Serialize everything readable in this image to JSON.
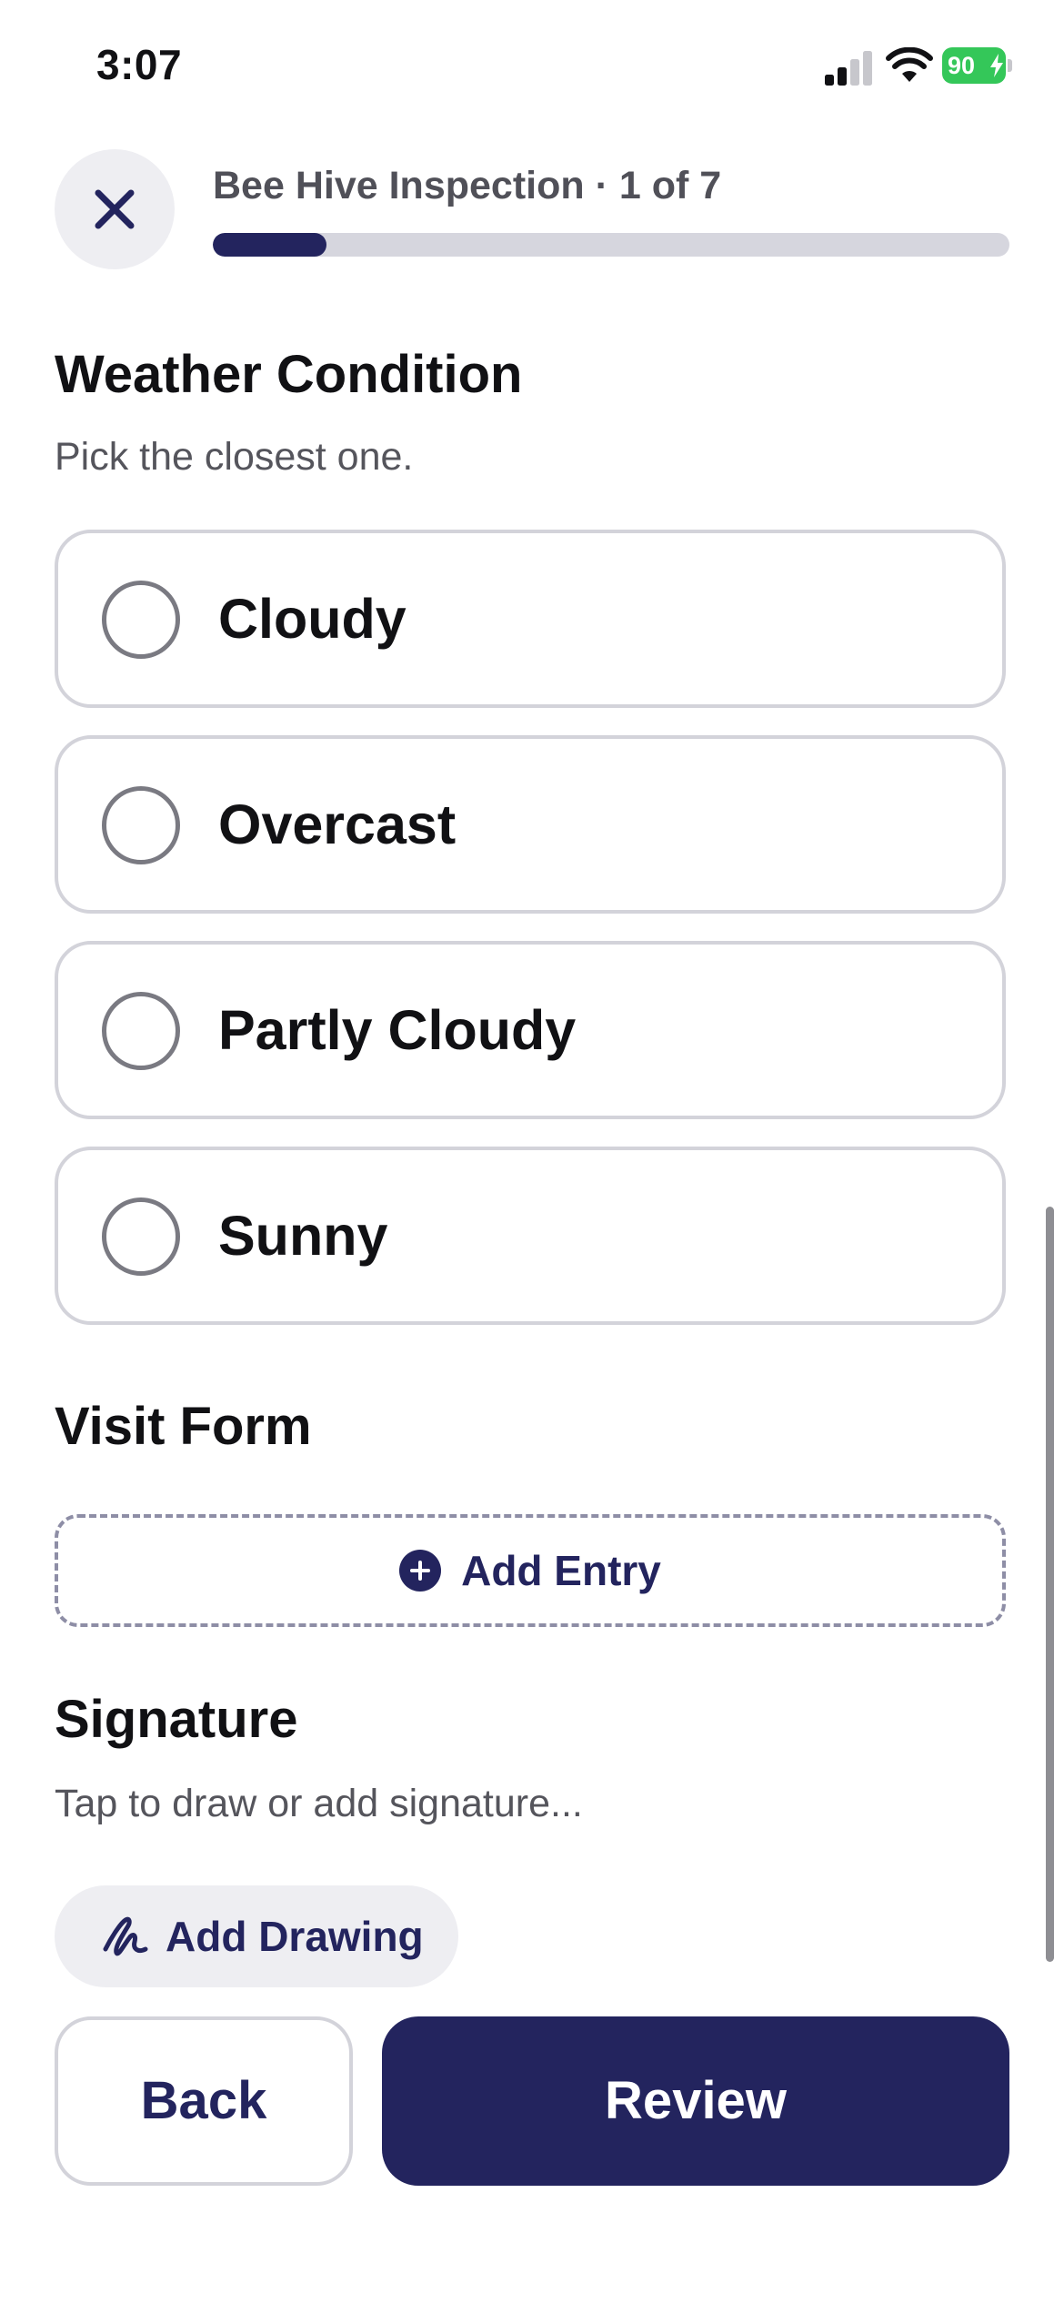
{
  "status_bar": {
    "time": "3:07",
    "battery": "90",
    "icons": [
      "signal-icon",
      "wifi-icon",
      "battery-charging-icon"
    ],
    "battery_color": "#34c759"
  },
  "header": {
    "close_icon": "close-icon",
    "title": "Bee Hive Inspection · 1 of 7",
    "progress_fraction": 0.142857
  },
  "weather": {
    "title": "Weather Condition",
    "subtitle": "Pick the closest one.",
    "options": [
      {
        "label": "Cloudy",
        "selected": false
      },
      {
        "label": "Overcast",
        "selected": false
      },
      {
        "label": "Partly Cloudy",
        "selected": false
      },
      {
        "label": "Sunny",
        "selected": false
      }
    ]
  },
  "visit_form": {
    "title": "Visit Form",
    "add_entry_label": "Add Entry",
    "add_icon": "plus-circle-icon"
  },
  "signature": {
    "title": "Signature",
    "placeholder": "Tap to draw or add signature...",
    "add_drawing_label": "Add Drawing",
    "drawing_icon": "signature-icon"
  },
  "footer": {
    "back_label": "Back",
    "review_label": "Review"
  },
  "colors": {
    "accent": "#23245e",
    "border": "#d3d3da",
    "muted_text": "#55555c",
    "chip_bg": "#eeeef2"
  }
}
